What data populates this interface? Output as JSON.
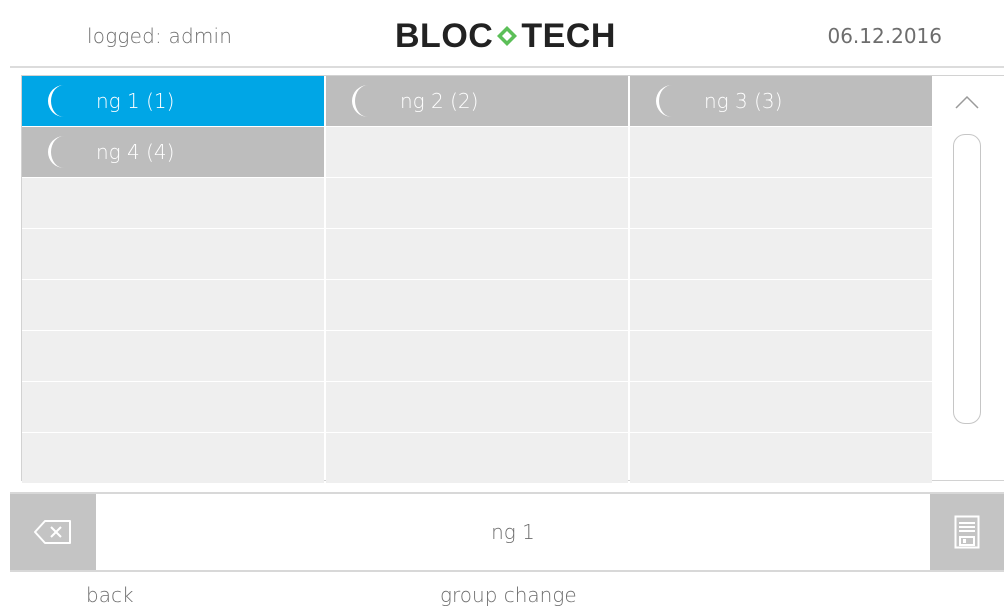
{
  "header": {
    "user_text": "logged: admin",
    "logo_left": "BLOC",
    "logo_right": "TECH",
    "date": "06.12.2016"
  },
  "groups": [
    {
      "label": "ng 1 (1)",
      "icon": "moon-icon",
      "selected": true
    },
    {
      "label": "ng 2 (2)",
      "icon": "moon-icon",
      "selected": false
    },
    {
      "label": "ng 3 (3)",
      "icon": "moon-icon",
      "selected": false
    },
    {
      "label": "ng 4 (4)",
      "icon": "moon-icon",
      "selected": false
    }
  ],
  "input": {
    "value": "ng 1",
    "clear_icon": "backspace-icon",
    "save_icon": "save-icon"
  },
  "footer": {
    "back_label": "back",
    "title": "group change"
  },
  "colors": {
    "selected": "#00a6e6",
    "tile": "#bdbdbd",
    "empty_cell": "#efefef",
    "logo_accent": "#5cbf58"
  }
}
